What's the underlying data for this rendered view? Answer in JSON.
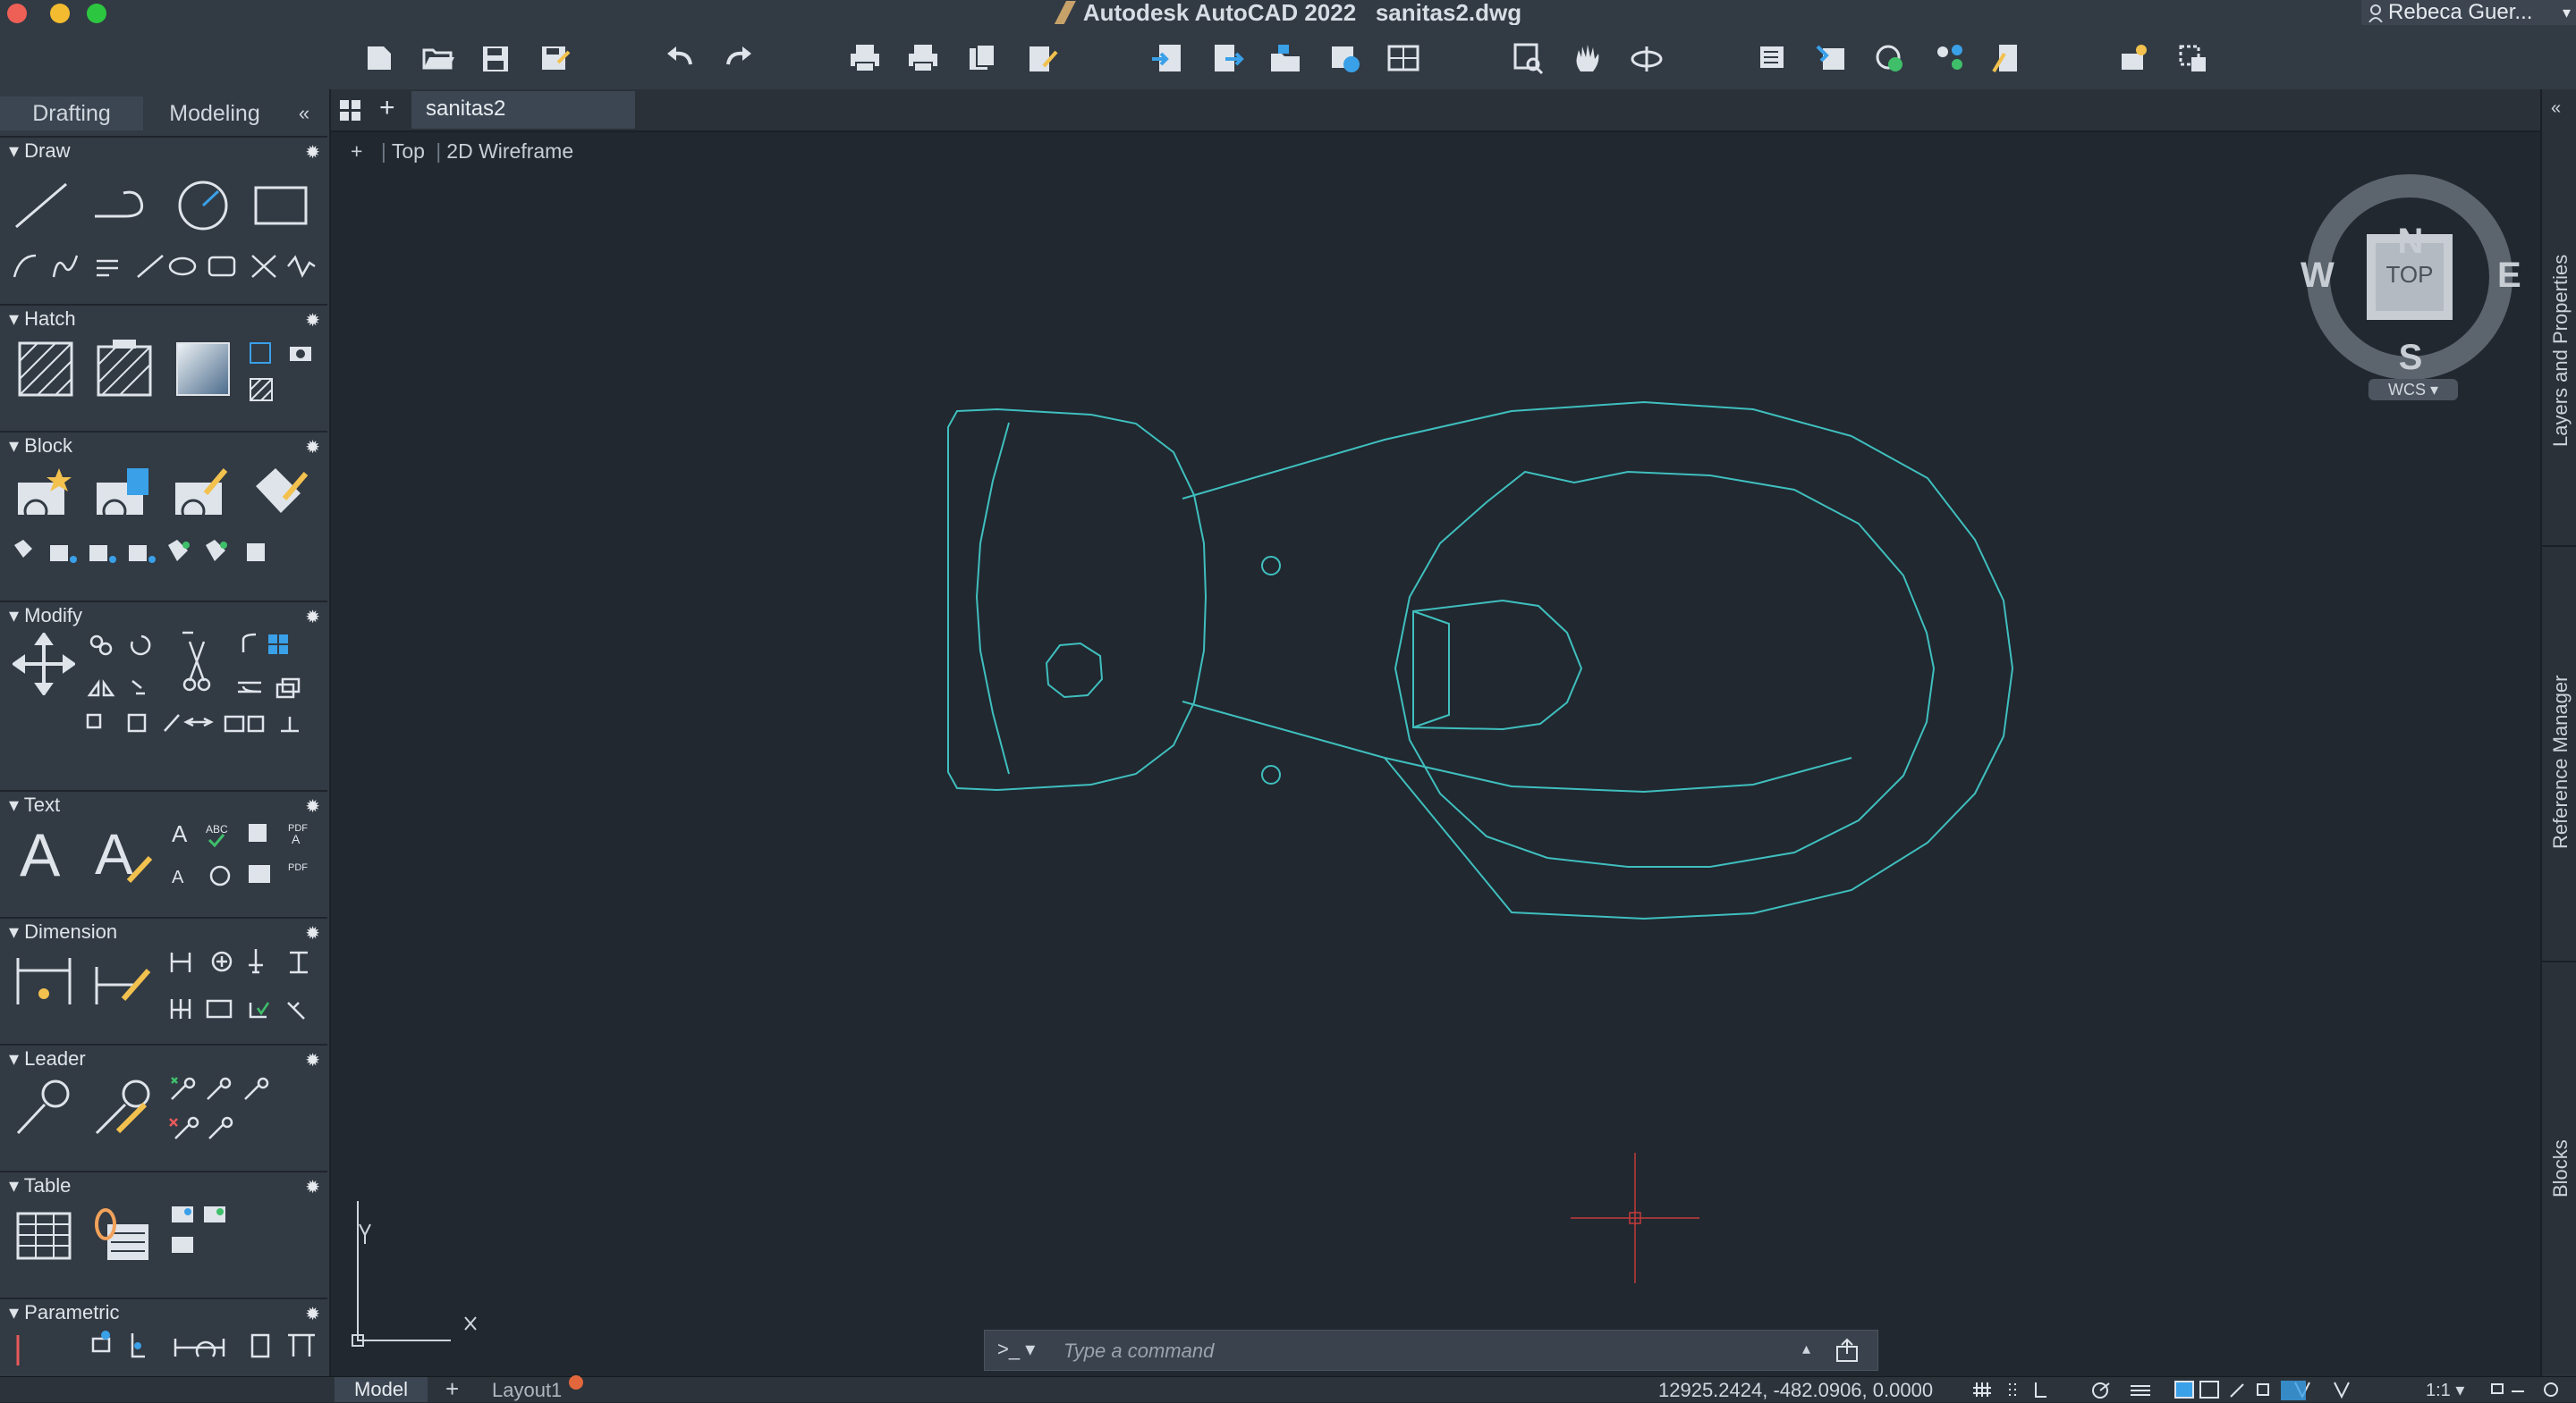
{
  "app": {
    "title": "Autodesk AutoCAD 2022",
    "filename": "sanitas2.dwg",
    "user": "Rebeca Guer..."
  },
  "left_panel": {
    "tabs": [
      "Drafting",
      "Modeling"
    ],
    "collapse_glyph": "«",
    "sections": [
      {
        "key": "draw",
        "label": "Draw"
      },
      {
        "key": "hatch",
        "label": "Hatch"
      },
      {
        "key": "block",
        "label": "Block"
      },
      {
        "key": "modify",
        "label": "Modify"
      },
      {
        "key": "text",
        "label": "Text"
      },
      {
        "key": "dimension",
        "label": "Dimension"
      },
      {
        "key": "leader",
        "label": "Leader"
      },
      {
        "key": "table",
        "label": "Table"
      },
      {
        "key": "parametric",
        "label": "Parametric"
      }
    ]
  },
  "document": {
    "tab_label": "sanitas2",
    "viewport_label": {
      "plus": "+",
      "view": "Top",
      "style": "2D Wireframe"
    }
  },
  "viewcube": {
    "north": "N",
    "south": "S",
    "east": "E",
    "west": "W",
    "face": "TOP",
    "wcs": "WCS"
  },
  "right_palettes": [
    "Layers and Properties",
    "Reference Manager",
    "Blocks"
  ],
  "ucs": {
    "x": "X",
    "y": "Y"
  },
  "command_line": {
    "prompt": ">_",
    "placeholder": "Type a command"
  },
  "status_bar": {
    "tabs": [
      "Model",
      "Layout1"
    ],
    "coordinates": "12925.2424, -482.0906, 0.0000",
    "scale": "1:1"
  },
  "colors": {
    "drawing_lines": "#3fbfbe",
    "crosshair": "#c43a3a",
    "background": "#212830",
    "panel": "#323a44"
  }
}
